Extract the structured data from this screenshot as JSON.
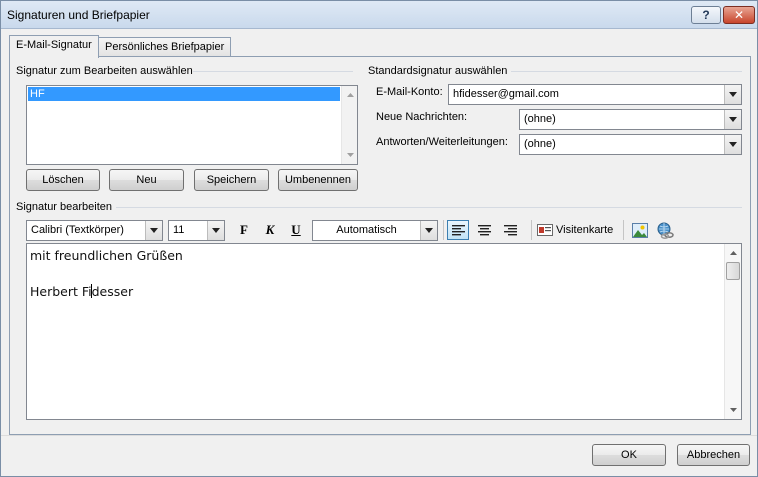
{
  "window": {
    "title": "Signaturen und Briefpapier",
    "help_glyph": "?",
    "close_glyph": "✕"
  },
  "tabs": [
    {
      "label": "E-Mail-Signatur",
      "active": true
    },
    {
      "label": "Persönliches Briefpapier",
      "active": false
    }
  ],
  "select_signature": {
    "group_label": "Signatur zum Bearbeiten auswählen",
    "items": [
      "HF"
    ],
    "selected": "HF",
    "buttons": {
      "delete": "Löschen",
      "new": "Neu",
      "save": "Speichern",
      "rename": "Umbenennen"
    }
  },
  "default_signature": {
    "group_label": "Standardsignatur auswählen",
    "account_label": "E-Mail-Konto:",
    "account_value": "hfidesser@gmail.com",
    "new_messages_label": "Neue Nachrichten:",
    "new_messages_value": "(ohne)",
    "replies_label": "Antworten/Weiterleitungen:",
    "replies_value": "(ohne)"
  },
  "edit_signature": {
    "group_label": "Signatur bearbeiten",
    "font": "Calibri (Textkörper)",
    "size": "11",
    "bold": "F",
    "italic": "K",
    "underline": "U",
    "color": "Automatisch",
    "business_card": "Visitenkarte",
    "text_before_caret": "Herbert Fi",
    "text_after_caret": "desser",
    "line1": "mit freundlichen Grüßen"
  },
  "footer": {
    "ok": "OK",
    "cancel": "Abbrechen"
  },
  "colors": {
    "selection": "#3399ff",
    "frame": "#7a8ea6"
  }
}
